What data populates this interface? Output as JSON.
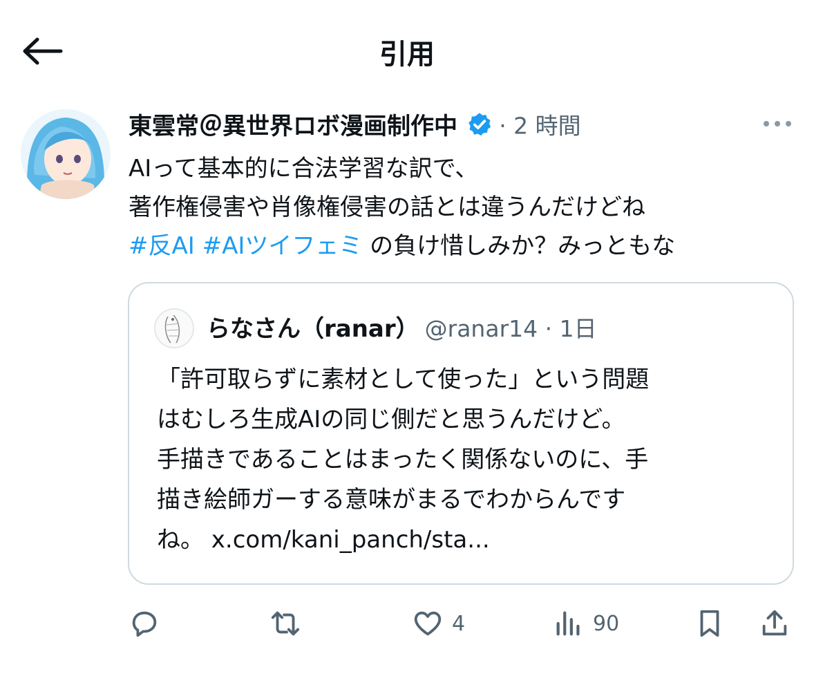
{
  "header": {
    "title": "引用"
  },
  "tweet": {
    "author_name": "東雲常＠異世界ロボ漫画制作中",
    "time": "· 2 時間",
    "text_line1": "AIって基本的に合法学習な訳で、",
    "text_line2": "著作権侵害や肖像権侵害の話とは違うんだけどね",
    "hashtag1": "#反AI",
    "hashtag2": "#AIツイフェミ",
    "text_line3_rest": " の負け惜しみか？みっともな"
  },
  "quote": {
    "author_name": "らなさん（ranar）",
    "handle_time": "@ranar14 · 1日",
    "lines": [
      "「許可取らずに素材として使った」という問題",
      "はむしろ生成AIの同じ側だと思うんだけど。",
      "手描きであることはまったく関係ないのに、手",
      "描き絵師ガーする意味がまるでわからんです",
      "ね。 x.com/kani_panch/sta..."
    ]
  },
  "actions": {
    "like_count": "4",
    "views_count": "90"
  },
  "colors": {
    "accent": "#1d9bf0",
    "muted": "#536471",
    "border": "#cfd9de"
  },
  "icons": [
    "arrow-left-icon",
    "verified-badge-icon",
    "more-icon",
    "reply-icon",
    "retweet-icon",
    "like-icon",
    "views-icon",
    "bookmark-icon",
    "share-icon"
  ]
}
